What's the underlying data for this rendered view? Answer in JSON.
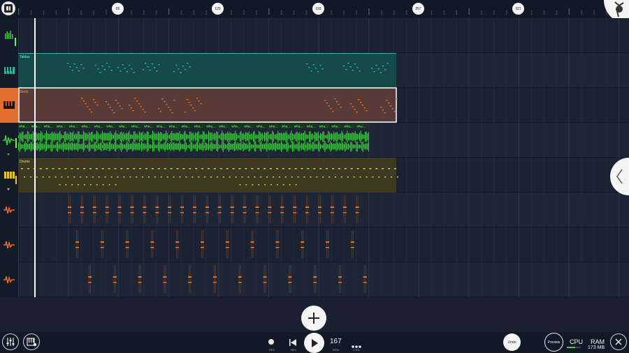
{
  "ruler": {
    "markers": [
      "65",
      "129",
      "193",
      "257",
      "321"
    ]
  },
  "clips": {
    "tablas": "Tablas",
    "sketz": "Sketz",
    "drums": "Drums",
    "audio_label": "wha..."
  },
  "transport": {
    "rec_label": "REC",
    "rev_label": "REV",
    "bpm_value": "167",
    "bpm_label": "BPM",
    "ctrl_label": "CTRL"
  },
  "buttons": {
    "undo": "Undo",
    "preview": "Preview"
  },
  "status": {
    "cpu_label": "CPU",
    "cpu_level": 0.6,
    "ram_label": "RAM",
    "ram_value": "173 MB"
  },
  "colors": {
    "tablas": "#2db8a0",
    "sketz": "#e2742d",
    "audio": "#33d333",
    "drums": "#e8c62c",
    "selected_track": "#e36d2d"
  },
  "icons": {
    "logo": "app-logo-icon",
    "corner": "fruit-logo-icon",
    "side": "chevron-left-icon",
    "add": "plus-icon",
    "mixer": "mixer-icon",
    "instruments": "piano-settings-icon",
    "close": "close-icon"
  }
}
